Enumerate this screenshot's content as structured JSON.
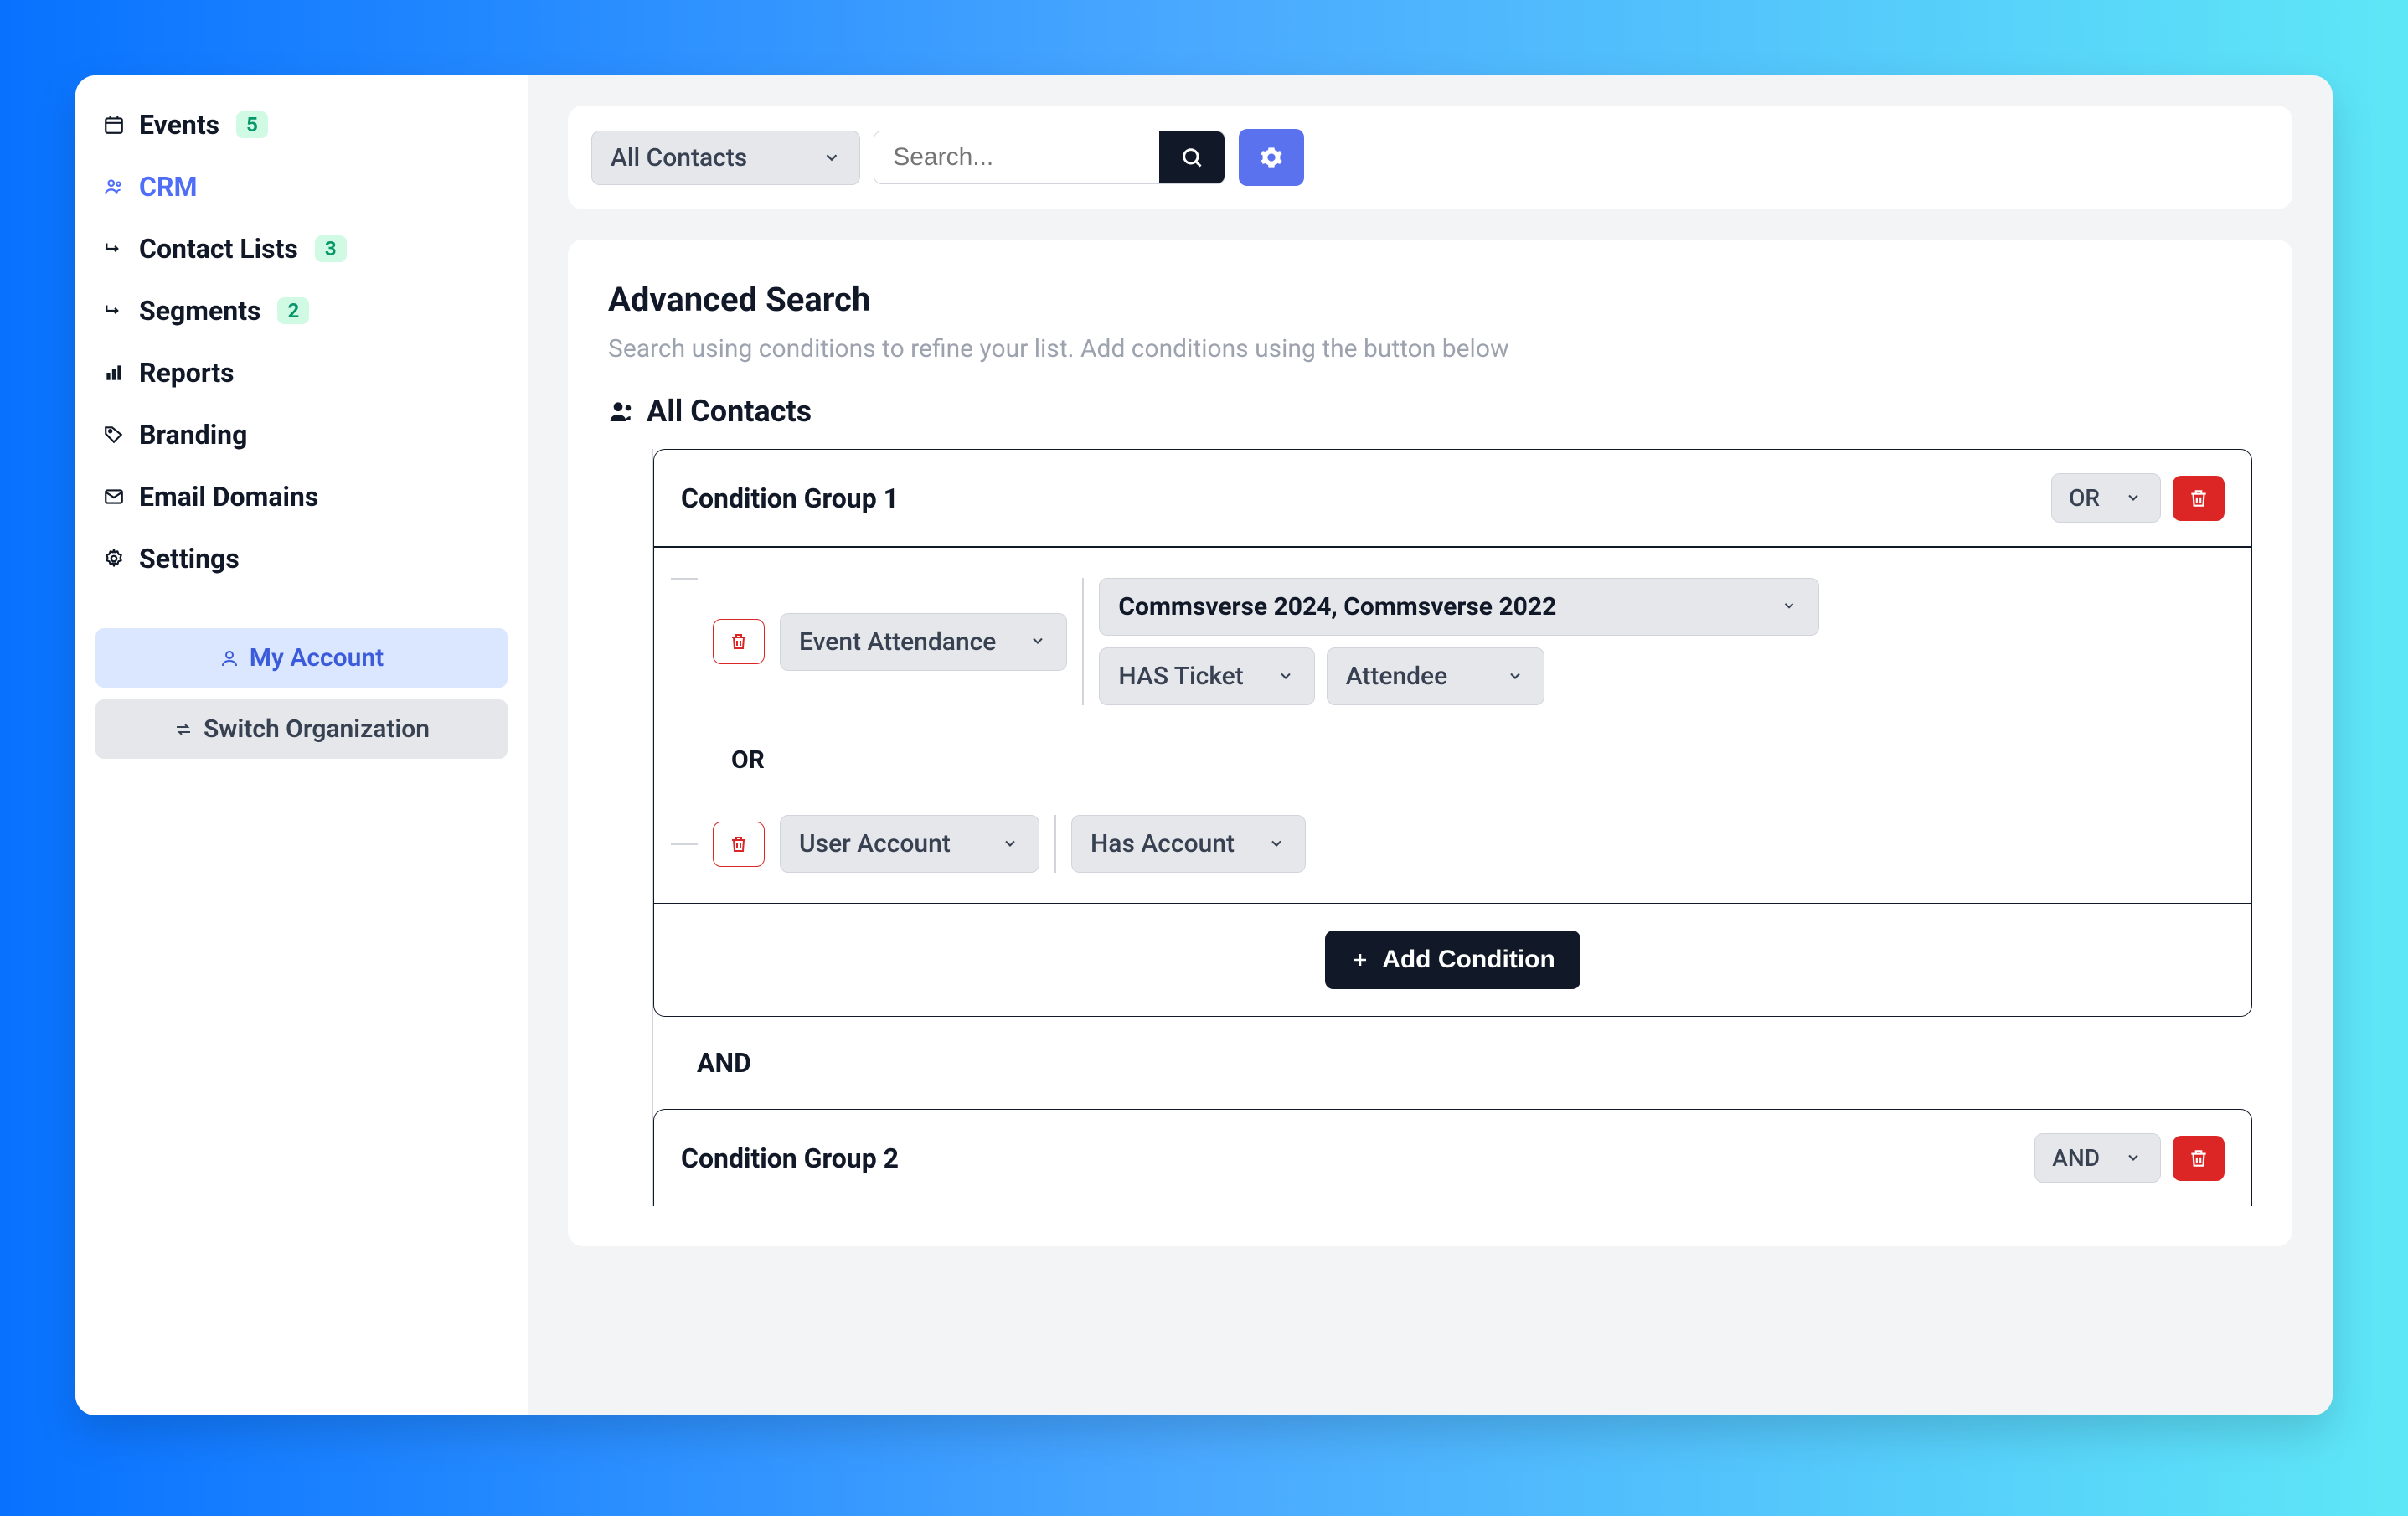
{
  "sidebar": {
    "items": [
      {
        "label": "Events",
        "badge": "5",
        "icon": "calendar",
        "active": false,
        "sub": false
      },
      {
        "label": "CRM",
        "badge": null,
        "icon": "people",
        "active": true,
        "sub": false
      },
      {
        "label": "Contact Lists",
        "badge": "3",
        "icon": "sub-arrow",
        "active": false,
        "sub": true
      },
      {
        "label": "Segments",
        "badge": "2",
        "icon": "sub-arrow",
        "active": false,
        "sub": true
      },
      {
        "label": "Reports",
        "badge": null,
        "icon": "chart",
        "active": false,
        "sub": false
      },
      {
        "label": "Branding",
        "badge": null,
        "icon": "tag",
        "active": false,
        "sub": false
      },
      {
        "label": "Email Domains",
        "badge": null,
        "icon": "mail",
        "active": false,
        "sub": false
      },
      {
        "label": "Settings",
        "badge": null,
        "icon": "gear",
        "active": false,
        "sub": false
      }
    ],
    "account_label": "My Account",
    "switch_label": "Switch Organization"
  },
  "toolbar": {
    "filter_value": "All Contacts",
    "search_placeholder": "Search..."
  },
  "advanced": {
    "title": "Advanced Search",
    "subtitle": "Search using conditions to refine your list. Add conditions using the button below",
    "header": "All Contacts"
  },
  "groups": [
    {
      "title": "Condition Group 1",
      "logic": "OR",
      "conditions": [
        {
          "field": "Event Attendance",
          "events_value": "Commsverse 2024, Commsverse 2022",
          "ticket_op": "HAS Ticket",
          "role": "Attendee"
        },
        {
          "field": "User Account",
          "account_op": "Has Account"
        }
      ],
      "inner_or": "OR",
      "add_label": "Add Condition"
    },
    {
      "title": "Condition Group 2",
      "logic": "AND"
    }
  ],
  "between_logic": "AND"
}
